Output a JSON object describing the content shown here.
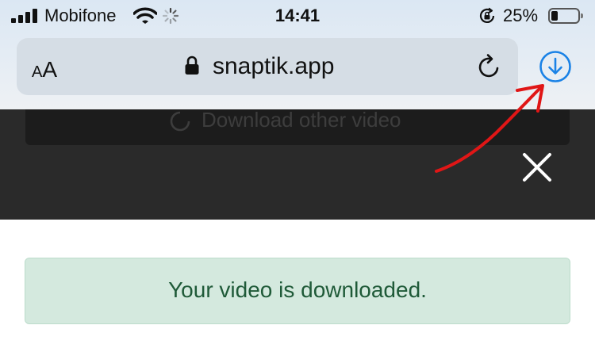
{
  "status_bar": {
    "carrier": "Mobifone",
    "time": "14:41",
    "battery_percent": "25%",
    "battery_level": 0.25
  },
  "browser": {
    "text_size_small": "A",
    "text_size_large": "A",
    "domain": "snaptik.app",
    "icons": [
      "lock-icon",
      "reload-icon",
      "download-icon"
    ]
  },
  "page": {
    "download_other_label": "Download other video",
    "close_icon": "close-icon",
    "success_message": "Your video is downloaded."
  },
  "colors": {
    "download_accent": "#1a82e6",
    "annotation_arrow": "#e01616",
    "alert_background": "#d4e9de",
    "alert_text": "#1f5a38",
    "overlay": "#2a2a2a"
  }
}
